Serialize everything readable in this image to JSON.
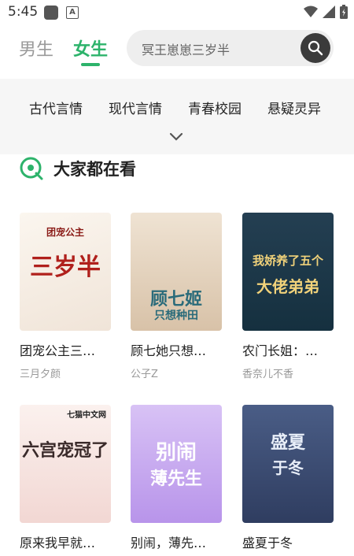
{
  "status": {
    "time": "5:45"
  },
  "header": {
    "tabs": [
      {
        "label": "男生"
      },
      {
        "label": "女生"
      }
    ],
    "search_placeholder": "冥王崽崽三岁半"
  },
  "categories": [
    "古代言情",
    "现代言情",
    "青春校园",
    "悬疑灵异"
  ],
  "section": {
    "title": "大家都在看"
  },
  "books": [
    {
      "title": "团宠公主三…",
      "author": "三月夕颜",
      "cover_text": "三岁半",
      "cover_sub": "团宠公主",
      "cover_color": "#f4efe8",
      "text_color": "#b0201c"
    },
    {
      "title": "顾七她只想…",
      "author": "公子Z",
      "cover_text": "顾七姬",
      "cover_sub": "只想种田",
      "cover_color": "#e9d9c7",
      "text_color": "#2a6b7a"
    },
    {
      "title": "农门长姐：…",
      "author": "香奈儿不香",
      "cover_text": "我娇养了五个",
      "cover_sub": "大佬弟弟",
      "cover_color": "#1f3a4a",
      "text_color": "#f1d27a"
    },
    {
      "title": "原来我早就…",
      "author": "",
      "cover_text": "六宫宠冠了",
      "cover_sub": "七猫中文网",
      "cover_color": "#f7ece8",
      "text_color": "#3a2a2a"
    },
    {
      "title": "别闹，薄先…",
      "author": "",
      "cover_text": "别闹",
      "cover_sub": "薄先生",
      "cover_color": "#cdb4f0",
      "text_color": "#ffffff"
    },
    {
      "title": "盛夏于冬",
      "author": "",
      "cover_text": "盛夏",
      "cover_sub": "于冬",
      "cover_color": "#3e4f76",
      "text_color": "#e8eef8"
    }
  ]
}
